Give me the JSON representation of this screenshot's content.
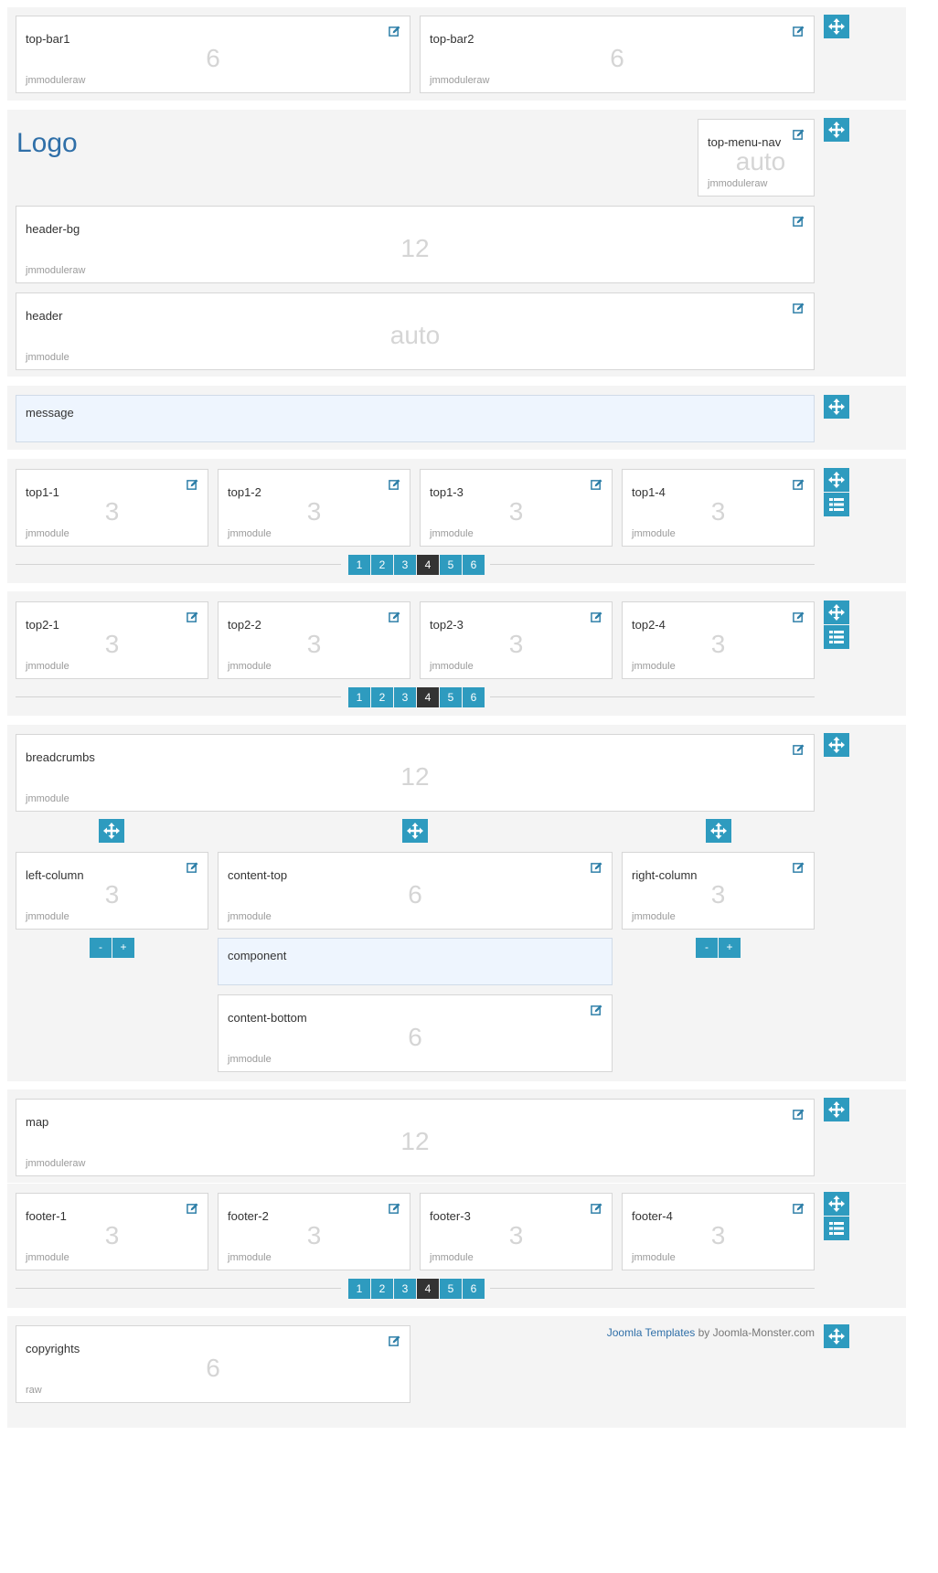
{
  "logo": "Logo",
  "footer": {
    "link": "Joomla Templates",
    "by": "by",
    "site": "Joomla-Monster.com"
  },
  "modules": {
    "top_bar1": {
      "title": "top-bar1",
      "size": "6",
      "style": "jmmoduleraw"
    },
    "top_bar2": {
      "title": "top-bar2",
      "size": "6",
      "style": "jmmoduleraw"
    },
    "top_menu_nav": {
      "title": "top-menu-nav",
      "size": "auto",
      "style": "jmmoduleraw"
    },
    "header_bg": {
      "title": "header-bg",
      "size": "12",
      "style": "jmmoduleraw"
    },
    "header": {
      "title": "header",
      "size": "auto",
      "style": "jmmodule"
    },
    "message": {
      "title": "message"
    },
    "top1_1": {
      "title": "top1-1",
      "size": "3",
      "style": "jmmodule"
    },
    "top1_2": {
      "title": "top1-2",
      "size": "3",
      "style": "jmmodule"
    },
    "top1_3": {
      "title": "top1-3",
      "size": "3",
      "style": "jmmodule"
    },
    "top1_4": {
      "title": "top1-4",
      "size": "3",
      "style": "jmmodule"
    },
    "top2_1": {
      "title": "top2-1",
      "size": "3",
      "style": "jmmodule"
    },
    "top2_2": {
      "title": "top2-2",
      "size": "3",
      "style": "jmmodule"
    },
    "top2_3": {
      "title": "top2-3",
      "size": "3",
      "style": "jmmodule"
    },
    "top2_4": {
      "title": "top2-4",
      "size": "3",
      "style": "jmmodule"
    },
    "breadcrumbs": {
      "title": "breadcrumbs",
      "size": "12",
      "style": "jmmodule"
    },
    "left_column": {
      "title": "left-column",
      "size": "3",
      "style": "jmmodule"
    },
    "content_top": {
      "title": "content-top",
      "size": "6",
      "style": "jmmodule"
    },
    "right_column": {
      "title": "right-column",
      "size": "3",
      "style": "jmmodule"
    },
    "component": {
      "title": "component"
    },
    "content_bottom": {
      "title": "content-bottom",
      "size": "6",
      "style": "jmmodule"
    },
    "map": {
      "title": "map",
      "size": "12",
      "style": "jmmoduleraw"
    },
    "footer_1": {
      "title": "footer-1",
      "size": "3",
      "style": "jmmodule"
    },
    "footer_2": {
      "title": "footer-2",
      "size": "3",
      "style": "jmmodule"
    },
    "footer_3": {
      "title": "footer-3",
      "size": "3",
      "style": "jmmodule"
    },
    "footer_4": {
      "title": "footer-4",
      "size": "3",
      "style": "jmmodule"
    },
    "copyrights": {
      "title": "copyrights",
      "size": "6",
      "style": "raw"
    }
  },
  "pagination": {
    "items": [
      "1",
      "2",
      "3",
      "4",
      "5",
      "6"
    ],
    "active": "4"
  },
  "column_buttons": {
    "minus": "-",
    "plus": "+"
  },
  "icons": {
    "edit": "edit-icon",
    "move": "move-icon",
    "list": "list-icon"
  },
  "colors": {
    "accent": "#2e9bbf",
    "active": "#333333",
    "logo": "#2f6fa8",
    "row_bg": "#f4f4f4",
    "highlight": "#eef5fe"
  }
}
